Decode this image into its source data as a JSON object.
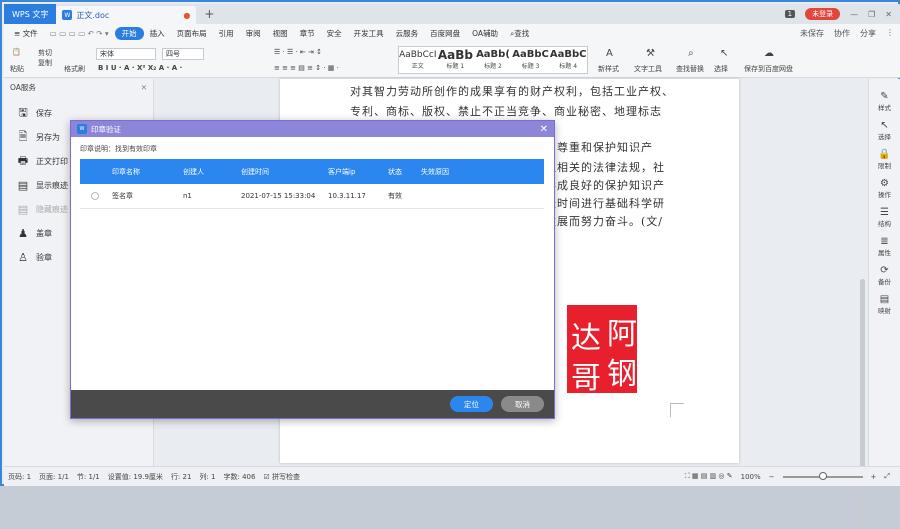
{
  "titlebar": {
    "app_tab": "WPS 文字",
    "doc_badge": "W",
    "doc_tab": "正文.doc",
    "badge": "1",
    "login": "未登录",
    "min": "—",
    "max": "❐",
    "close": "✕"
  },
  "menubar": {
    "file": "≡ 文件",
    "items": [
      "开始",
      "插入",
      "页面布局",
      "引用",
      "审阅",
      "视图",
      "章节",
      "安全",
      "开发工具",
      "云服务",
      "百度网盘",
      "OA辅助",
      "查找"
    ],
    "right": [
      "未保存",
      "协作",
      "分享"
    ]
  },
  "ribbon": {
    "cut": "剪切",
    "copy": "复制",
    "paste": "粘贴",
    "format_painter": "格式刷",
    "font": "宋体",
    "size": "四号",
    "styles": [
      {
        "preview": "AaBbCcI",
        "name": "正文"
      },
      {
        "preview": "AaBb",
        "name": "标题 1"
      },
      {
        "preview": "AaBb(",
        "name": "标题 2"
      },
      {
        "preview": "AaBbC",
        "name": "标题 3"
      },
      {
        "preview": "AaBbC",
        "name": "标题 4"
      }
    ],
    "new_style": "新样式",
    "text_tools": "文字工具",
    "find_replace": "查找替换",
    "select": "选择",
    "save_baidu": "保存到百度网盘"
  },
  "panel": {
    "title": "OA服务",
    "items": [
      {
        "label": "保存",
        "enabled": true
      },
      {
        "label": "另存为",
        "enabled": true
      },
      {
        "label": "正文打印",
        "enabled": true
      },
      {
        "label": "显示痕迹",
        "enabled": true
      },
      {
        "label": "隐藏痕迹",
        "enabled": false
      },
      {
        "label": "盖章",
        "enabled": true
      },
      {
        "label": "验章",
        "enabled": true
      }
    ]
  },
  "document": {
    "lines_full": [
      "对其智力劳动所创作的成果享有的财产权利，包括工业产权、",
      "专利、商标、版权、禁止不正当竞争、商业秘密、地理标志"
    ],
    "lines_right": [
      "，尊重和保护知识产",
      "立相关的法律法规，社",
      "形成良好的保护知识产",
      "长时间进行基础科学研",
      "发展而努力奋斗。(文/"
    ],
    "seal_chars": [
      "阿",
      "钢",
      "达",
      "哥"
    ]
  },
  "sidebar_right": [
    {
      "icon": "✎",
      "label": "样式"
    },
    {
      "icon": "↖",
      "label": "选择"
    },
    {
      "icon": "🔒",
      "label": "限制"
    },
    {
      "icon": "⚙",
      "label": "操作"
    },
    {
      "icon": "☰",
      "label": "结构"
    },
    {
      "icon": "≣",
      "label": "属性"
    },
    {
      "icon": "⟳",
      "label": "备份"
    },
    {
      "icon": "▤",
      "label": "映射"
    }
  ],
  "statusbar": {
    "page_no": "页码: 1",
    "pages": "页面: 1/1",
    "section": "节: 1/1",
    "setting": "设置值: 19.9厘米",
    "row": "行: 21",
    "col": "列: 1",
    "words": "字数: 406",
    "spell": "拼写检查",
    "zoom": "100%"
  },
  "dialog": {
    "icon": "W",
    "title": "印章验证",
    "note": "印章说明：找到有效印章",
    "columns": [
      "印章名称",
      "创建人",
      "创建时间",
      "客户端ip",
      "状态",
      "失效原因"
    ],
    "rows": [
      {
        "name": "签名章",
        "creator": "n1",
        "time": "2021-07-15 15:33:04",
        "ip": "10.3.11.17",
        "status": "有效",
        "reason": ""
      }
    ],
    "locate_button": "定位",
    "cancel_button": "取消"
  }
}
